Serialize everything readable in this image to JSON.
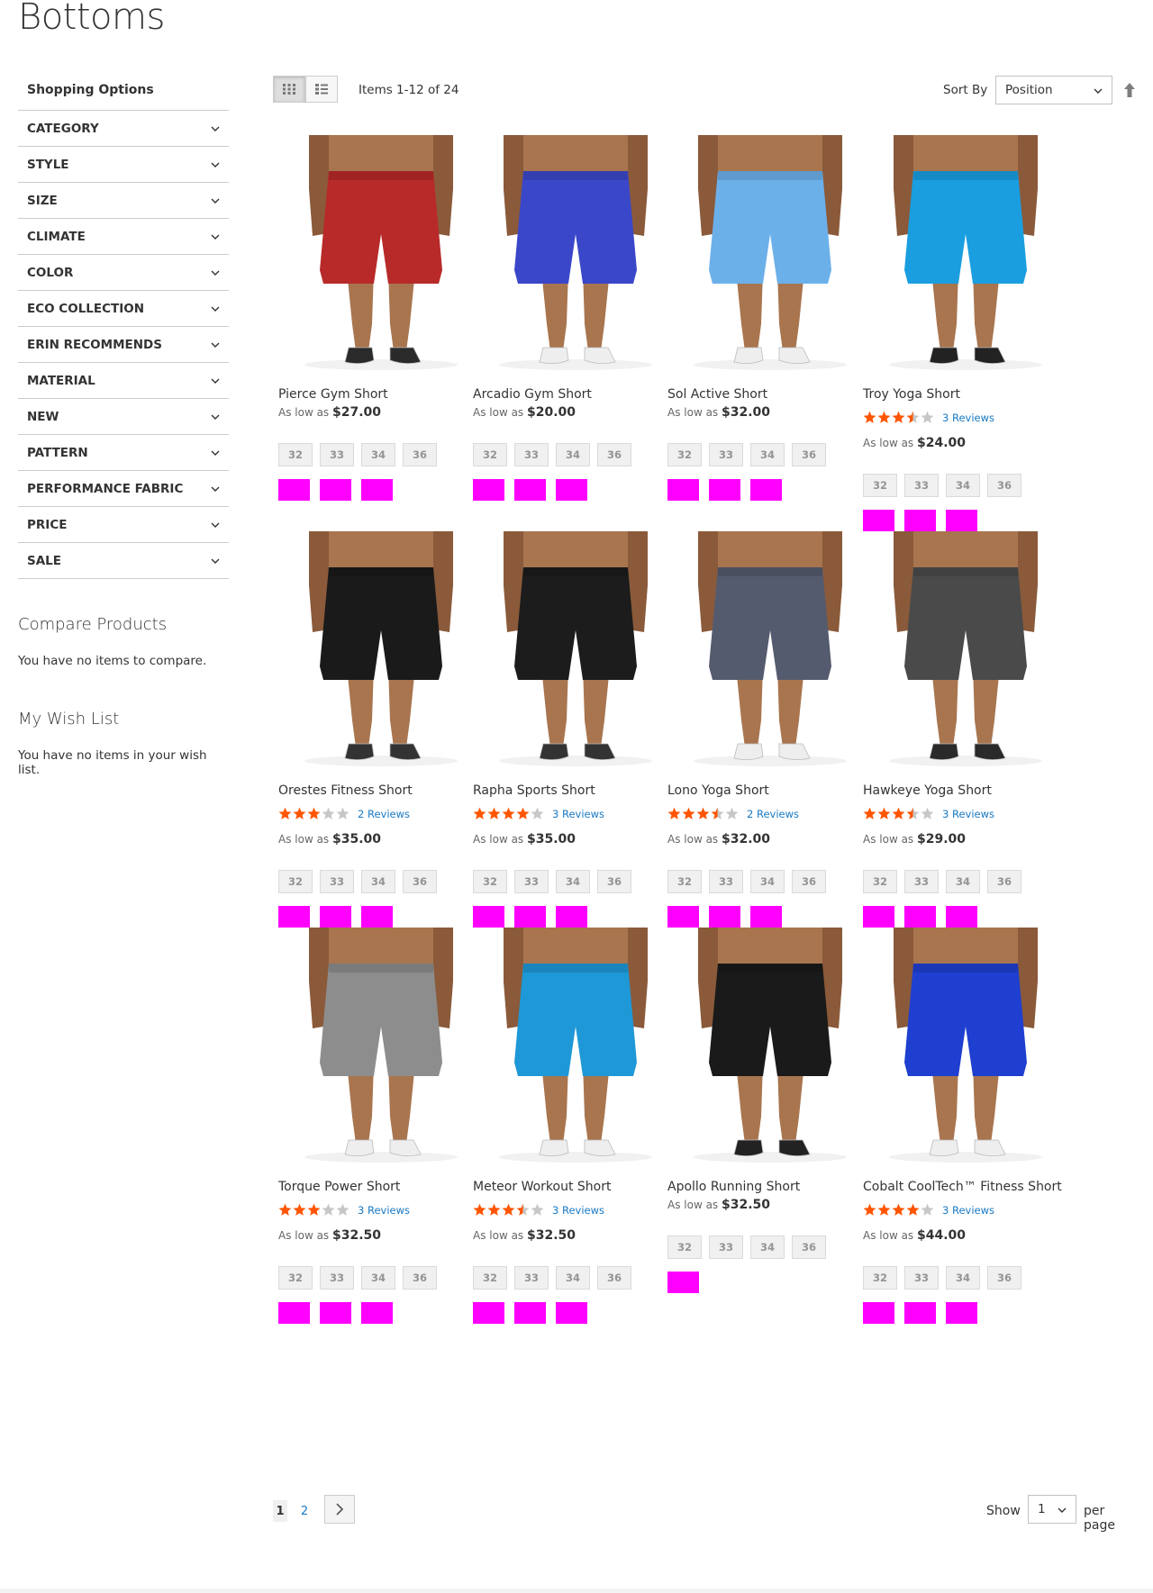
{
  "page": {
    "title": "Bottoms"
  },
  "sidebar": {
    "heading": "Shopping Options",
    "filters": [
      "CATEGORY",
      "STYLE",
      "SIZE",
      "CLIMATE",
      "COLOR",
      "ECO COLLECTION",
      "ERIN RECOMMENDS",
      "MATERIAL",
      "NEW",
      "PATTERN",
      "PERFORMANCE FABRIC",
      "PRICE",
      "SALE"
    ],
    "compare": {
      "title": "Compare Products",
      "empty": "You have no items to compare."
    },
    "wishlist": {
      "title": "My Wish List",
      "empty": "You have no items in your wish list."
    }
  },
  "toolbar": {
    "items_count": "Items 1-12 of 24",
    "sort_label": "Sort By",
    "sort_value": "Position",
    "view_modes": [
      "grid-icon",
      "list-icon"
    ]
  },
  "products": [
    {
      "name": "Pierce Gym Short",
      "price_prefix": "As low as",
      "price": "$27.00",
      "rating": null,
      "reviews": null,
      "sizes": [
        "32",
        "33",
        "34",
        "36"
      ],
      "swatches": 3,
      "short_color": "#b82a2a",
      "shoe_color": "#2a2a2a"
    },
    {
      "name": "Arcadio Gym Short",
      "price_prefix": "As low as",
      "price": "$20.00",
      "rating": null,
      "reviews": null,
      "sizes": [
        "32",
        "33",
        "34",
        "36"
      ],
      "swatches": 3,
      "short_color": "#3b47c9",
      "shoe_color": "#eeeeee"
    },
    {
      "name": "Sol Active Short",
      "price_prefix": "As low as",
      "price": "$32.00",
      "rating": null,
      "reviews": null,
      "sizes": [
        "32",
        "33",
        "34",
        "36"
      ],
      "swatches": 3,
      "short_color": "#6cb0ea",
      "shoe_color": "#eeeeee"
    },
    {
      "name": "Troy Yoga Short",
      "price_prefix": "As low as",
      "price": "$24.00",
      "rating": 3.5,
      "reviews": "3 Reviews",
      "sizes": [
        "32",
        "33",
        "34",
        "36"
      ],
      "swatches": 3,
      "short_color": "#1a9ee0",
      "shoe_color": "#222222"
    },
    {
      "name": "Orestes Fitness Short",
      "price_prefix": "As low as",
      "price": "$35.00",
      "rating": 3,
      "reviews": "2 Reviews",
      "sizes": [
        "32",
        "33",
        "34",
        "36"
      ],
      "swatches": 3,
      "short_color": "#1a1a1a",
      "shoe_color": "#333333"
    },
    {
      "name": "Rapha Sports Short",
      "price_prefix": "As low as",
      "price": "$35.00",
      "rating": 4,
      "reviews": "3 Reviews",
      "sizes": [
        "32",
        "33",
        "34",
        "36"
      ],
      "swatches": 3,
      "short_color": "#1c1c1c",
      "shoe_color": "#333333"
    },
    {
      "name": "Lono Yoga Short",
      "price_prefix": "As low as",
      "price": "$32.00",
      "rating": 3.5,
      "reviews": "2 Reviews",
      "sizes": [
        "32",
        "33",
        "34",
        "36"
      ],
      "swatches": 3,
      "short_color": "#555b6e",
      "shoe_color": "#eeeeee"
    },
    {
      "name": "Hawkeye Yoga Short",
      "price_prefix": "As low as",
      "price": "$29.00",
      "rating": 3.5,
      "reviews": "3 Reviews",
      "sizes": [
        "32",
        "33",
        "34",
        "36"
      ],
      "swatches": 3,
      "short_color": "#4a4a4a",
      "shoe_color": "#2a2a2a"
    },
    {
      "name": "Torque Power Short",
      "price_prefix": "As low as",
      "price": "$32.50",
      "rating": 3,
      "reviews": "3 Reviews",
      "sizes": [
        "32",
        "33",
        "34",
        "36"
      ],
      "swatches": 3,
      "short_color": "#8d8d8d",
      "shoe_color": "#eeeeee"
    },
    {
      "name": "Meteor Workout Short",
      "price_prefix": "As low as",
      "price": "$32.50",
      "rating": 3.5,
      "reviews": "3 Reviews",
      "sizes": [
        "32",
        "33",
        "34",
        "36"
      ],
      "swatches": 3,
      "short_color": "#1e98d6",
      "shoe_color": "#eeeeee"
    },
    {
      "name": "Apollo Running Short",
      "price_prefix": "As low as",
      "price": "$32.50",
      "rating": null,
      "reviews": null,
      "sizes": [
        "32",
        "33",
        "34",
        "36"
      ],
      "swatches": 1,
      "short_color": "#1a1a1a",
      "shoe_color": "#222222"
    },
    {
      "name": "Cobalt CoolTech™ Fitness Short",
      "price_prefix": "As low as",
      "price": "$44.00",
      "rating": 4,
      "reviews": "3 Reviews",
      "sizes": [
        "32",
        "33",
        "34",
        "36"
      ],
      "swatches": 3,
      "short_color": "#1f3fd0",
      "shoe_color": "#eeeeee"
    }
  ],
  "pager": {
    "current": "1",
    "pages": [
      "2"
    ],
    "show_label": "Show",
    "limit": "1",
    "per_page_label": "per page"
  },
  "colors": {
    "swatch": "#ff00ff",
    "star_on": "#ff5501",
    "star_off": "#c7c7c7",
    "link": "#1979c3"
  }
}
